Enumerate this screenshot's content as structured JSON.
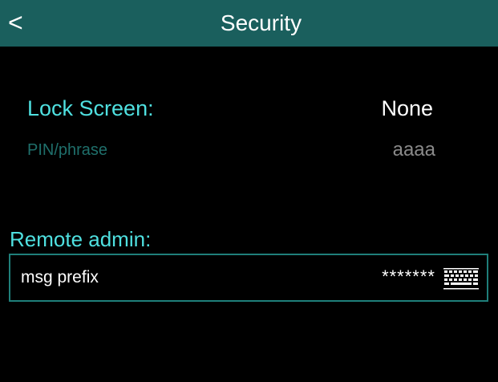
{
  "header": {
    "back_label": "<",
    "title": "Security",
    "background_color": "#1a5f5d"
  },
  "lock_screen": {
    "label": "Lock Screen:",
    "value": "None"
  },
  "pin": {
    "label": "PIN/phrase",
    "value": "aaaa"
  },
  "remote_admin": {
    "label": "Remote admin:",
    "msg_prefix": {
      "label": "msg prefix",
      "value": "*******",
      "icon": "keyboard-icon"
    }
  },
  "colors": {
    "accent": "#4fe0e0",
    "disabled_label": "#1f6f6b",
    "disabled_value": "#8a8a8a",
    "row_border": "#1f7f7a"
  }
}
